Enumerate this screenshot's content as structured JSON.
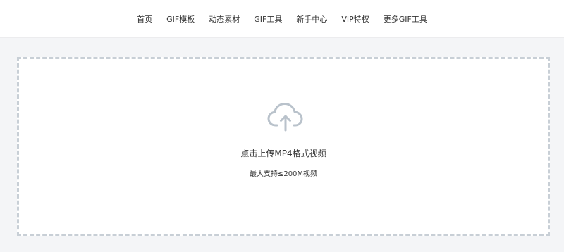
{
  "nav": {
    "items": [
      {
        "label": "首页"
      },
      {
        "label": "GIF模板"
      },
      {
        "label": "动态素材"
      },
      {
        "label": "GIF工具"
      },
      {
        "label": "新手中心"
      },
      {
        "label": "VIP特权"
      },
      {
        "label": "更多GIF工具"
      }
    ]
  },
  "upload": {
    "icon": "cloud-upload-icon",
    "primary_text": "点击上传MP4格式视频",
    "secondary_text": "最大支持≤200M视频",
    "border_color": "#c8cfd6",
    "icon_color": "#b9c2cb"
  }
}
